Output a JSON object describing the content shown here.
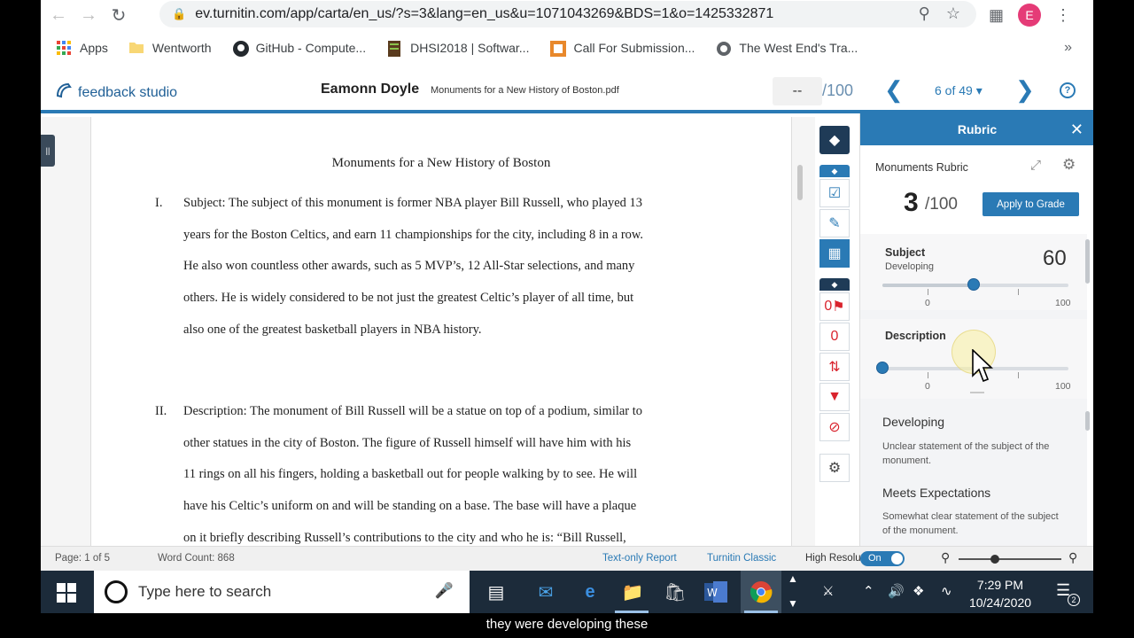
{
  "browser": {
    "url": "ev.turnitin.com/app/carta/en_us/?s=3&lang=en_us&u=1071043269&BDS=1&o=1425332871",
    "avatar_letter": "E",
    "bookmarks": [
      {
        "label": "Apps",
        "icon": "apps-grid-icon"
      },
      {
        "label": "Wentworth",
        "icon": "folder-icon"
      },
      {
        "label": "GitHub - Compute...",
        "icon": "github-icon"
      },
      {
        "label": "DHSI2018 | Softwar...",
        "icon": "doc-icon"
      },
      {
        "label": "Call For Submission...",
        "icon": "site-icon"
      },
      {
        "label": "The West End's Tra...",
        "icon": "globe-icon"
      }
    ]
  },
  "header": {
    "logo": "feedback studio",
    "student": "Eamonn Doyle",
    "file": "Monuments for a New History of Boston.pdf",
    "score_placeholder": "--",
    "score_total": "/100",
    "pager": "6 of 49"
  },
  "document": {
    "title": "Monuments for a New History of Boston",
    "sections": [
      {
        "num": "I.",
        "lines": [
          "Subject: The subject of this monument is former NBA player Bill Russell, who played 13",
          "years for the Boston Celtics, and earn 11 championships for the city, including 8 in a row.",
          "He also won countless other awards, such as 5 MVP’s, 12 All-Star selections, and many",
          "others. He is widely considered to be not just the greatest Celtic’s player of all time, but",
          "also one of the greatest basketball players in NBA history."
        ]
      },
      {
        "num": "II.",
        "lines": [
          "Description: The monument of Bill Russell will be a statue on top of a podium, similar to",
          "other statues in the city of Boston. The figure of Russell himself will have him with his",
          "11 rings on all his fingers, holding a basketball out for people walking by to see. He will",
          "have his Celtic’s uniform on and will be standing on a base. The base will have a plaque",
          "on it briefly describing Russell’s contributions to the city and who he is: “Bill Russell,"
        ]
      }
    ]
  },
  "rail": {
    "flag_count": "0",
    "count": "0"
  },
  "rubric": {
    "title": "Rubric",
    "name": "Monuments Rubric",
    "score": "3",
    "score_total": "/100",
    "apply_label": "Apply to Grade",
    "criteria": [
      {
        "name": "Subject",
        "level": "Developing",
        "value": "60",
        "slider_fraction": 0.49,
        "min_label": "0",
        "max_label": "100"
      },
      {
        "name": "Description",
        "level": "",
        "value": "",
        "slider_fraction": 0.0,
        "min_label": "0",
        "max_label": "100"
      }
    ],
    "levels": [
      {
        "title": "Developing",
        "desc": "Unclear statement of the subject of the monument."
      },
      {
        "title": "Meets Expectations",
        "desc": "Somewhat clear statement of the subject of the monument."
      }
    ]
  },
  "statusbar": {
    "page": "Page: 1 of 5",
    "word_count": "Word Count: 868",
    "text_only": "Text-only Report",
    "classic": "Turnitin Classic",
    "high_res": "High Resolution",
    "toggle": "On"
  },
  "taskbar": {
    "search_placeholder": "Type here to search",
    "time": "7:29 PM",
    "date": "10/24/2020",
    "notifications": "2"
  },
  "caption": "they were developing these",
  "colors": {
    "accent": "#2a7ab5",
    "danger": "#d9232d",
    "taskbar": "#1c2b3a"
  }
}
